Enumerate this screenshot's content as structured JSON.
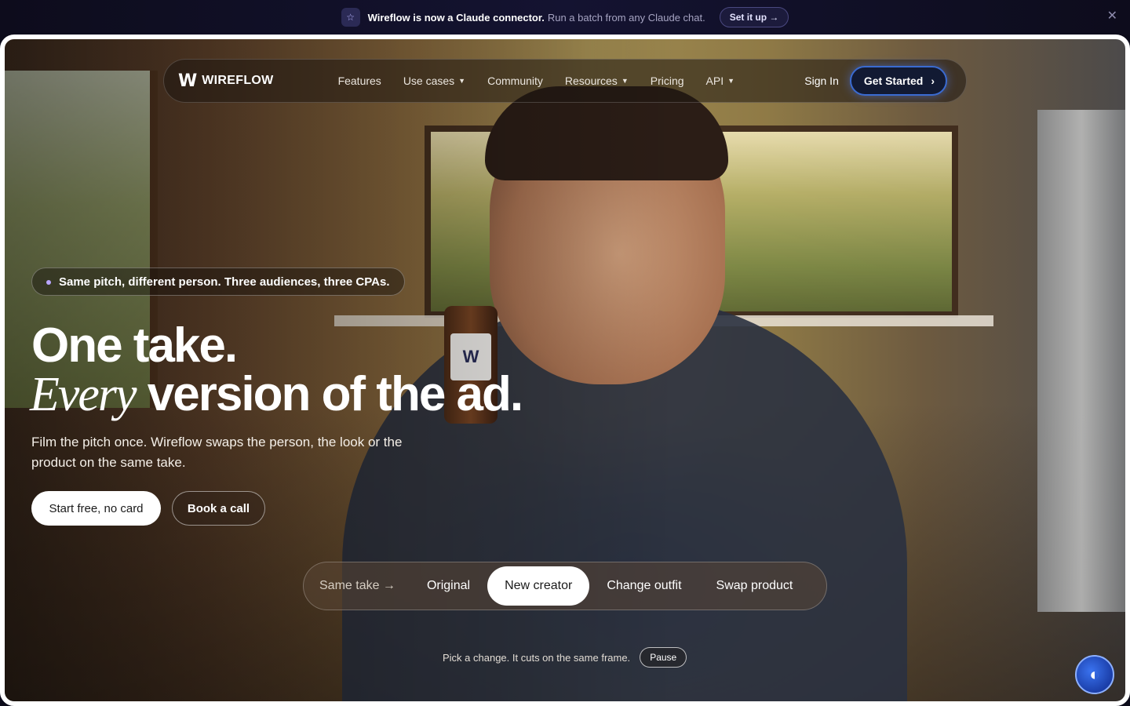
{
  "announcement": {
    "icon": "star-icon",
    "strong_text": "Wireflow is now a Claude connector.",
    "rest_text": "Run a batch from any Claude chat.",
    "cta_label": "Set it up →",
    "close_label": "✕"
  },
  "nav": {
    "logo_mark": "W",
    "logo_text": "WIREFLOW",
    "links": [
      {
        "label": "Features",
        "has_dropdown": false
      },
      {
        "label": "Use cases",
        "has_dropdown": true
      },
      {
        "label": "Community",
        "has_dropdown": false
      },
      {
        "label": "Resources",
        "has_dropdown": true
      },
      {
        "label": "Pricing",
        "has_dropdown": false
      },
      {
        "label": "API",
        "has_dropdown": true
      }
    ],
    "sign_in": "Sign In",
    "get_started": "Get Started",
    "get_started_chevron": "›",
    "accent_color": "#3a6bd1"
  },
  "hero": {
    "pill": "Same pitch, different person. Three audiences, three CPAs.",
    "headline_line1": "One take.",
    "headline_italic": "Every",
    "headline_rest": "version of the ad.",
    "subcopy": "Film the pitch once. Wireflow swaps the person, the look or the product on the same take.",
    "primary_cta": "Start free, no card",
    "secondary_cta": "Book a call",
    "product_label": "W"
  },
  "switcher": {
    "label": "Same take →",
    "options": [
      {
        "label": "Original",
        "active": false
      },
      {
        "label": "New creator",
        "active": true
      },
      {
        "label": "Change outfit",
        "active": false
      },
      {
        "label": "Swap product",
        "active": false
      }
    ]
  },
  "hint": {
    "text": "Pick a change. It cuts on the same frame.",
    "pause_label": "Pause"
  },
  "chat_widget": {
    "icon": "chat-assistant-icon",
    "glyph": "◐"
  }
}
